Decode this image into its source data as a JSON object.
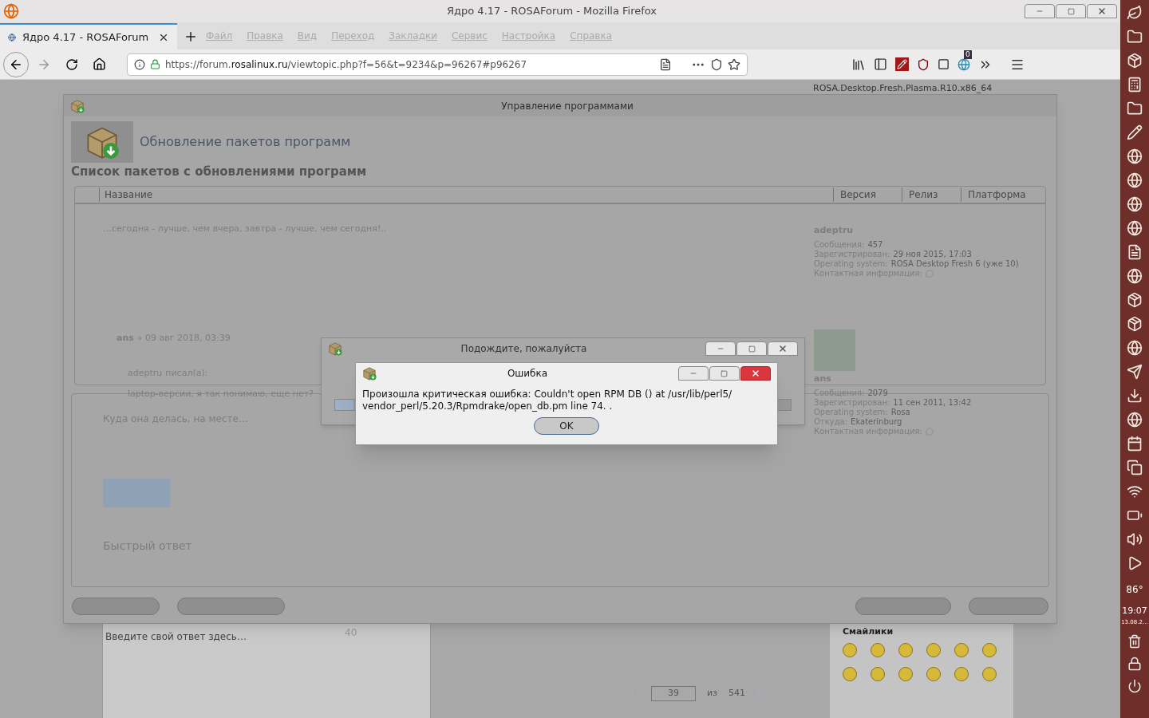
{
  "browser": {
    "window_title": "Ядро 4.17 - ROSAForum - Mozilla Firefox",
    "tabs": [
      {
        "label": "Ядро 4.17 - ROSAForum",
        "selected": true
      }
    ],
    "menu_ghost": [
      "Файл",
      "Правка",
      "Вид",
      "Переход",
      "Закладки",
      "Сервис",
      "Настройка",
      "Справка"
    ],
    "url_prefix": "https://forum.",
    "url_host": "rosalinux.ru",
    "url_path": "/viewtopic.php?f=56&t=9234&p=96267#p96267",
    "badge": "0"
  },
  "app_window": {
    "title": "Управление программами",
    "header_title": "Обновление пакетов программ",
    "list_title": "Список пакетов с обновлениями программ",
    "columns": [
      {
        "label": "Название"
      },
      {
        "label": "Версия"
      },
      {
        "label": "Релиз"
      },
      {
        "label": "Платформа"
      }
    ]
  },
  "wait_dialog": {
    "title": "Подождите, пожалуйста",
    "level": 0.04
  },
  "error_dialog": {
    "title": "Ошибка",
    "message": "Произошла критическая ошибка: Couldn't open RPM DB () at /usr/lib/perl5/ vendor_perl/5.20.3/Rpmdrake/open_db.pm line 74. .",
    "ok": "OK"
  },
  "forum_ghost": {
    "top_line": "ROSA.Desktop.Fresh.Plasma.R10.x86_64",
    "signature": "…сегодня - лучше, чем вчера, завтра - лучше, чем сегодня!..",
    "post_author": "ans",
    "post_date": "» 09 авг 2018, 03:39",
    "quote_author": "adeptru",
    "quote_suffix": "писал(а):",
    "quote_text": "laptop-версии, я так понимаю, еще нет?",
    "post_text": "Куда она делась, на месте…",
    "quick_reply": "Быстрый ответ",
    "profiles": [
      {
        "name": "adeptru",
        "avatar": false,
        "fields": [
          {
            "label": "Сообщения:",
            "value": "457"
          },
          {
            "label": "Зарегистрирован:",
            "value": "29 ноя 2015, 17:03"
          },
          {
            "label": "Operating system:",
            "value": "ROSA Desktop Fresh 6 (уже 10)"
          },
          {
            "label": "Контактная информация:"
          }
        ]
      },
      {
        "name": "ans",
        "avatar": true,
        "fields": [
          {
            "label": "Сообщения:",
            "value": "2079"
          },
          {
            "label": "Зарегистрирован:",
            "value": "11 сен 2011, 13:42"
          },
          {
            "label": "Operating system:",
            "value": "Rosa"
          },
          {
            "label": "Откуда:",
            "value": "Ekaterinburg"
          },
          {
            "label": "Контактная информация:"
          }
        ]
      }
    ],
    "reply_placeholder": "Введите свой ответ здесь…",
    "page_count": "40",
    "pager": {
      "current": "39",
      "of": "из",
      "total": "541"
    },
    "smileys_title": "Смайлики"
  },
  "panel": {
    "temperature": "86°",
    "time": "19:07",
    "date": "13.08.2…"
  }
}
